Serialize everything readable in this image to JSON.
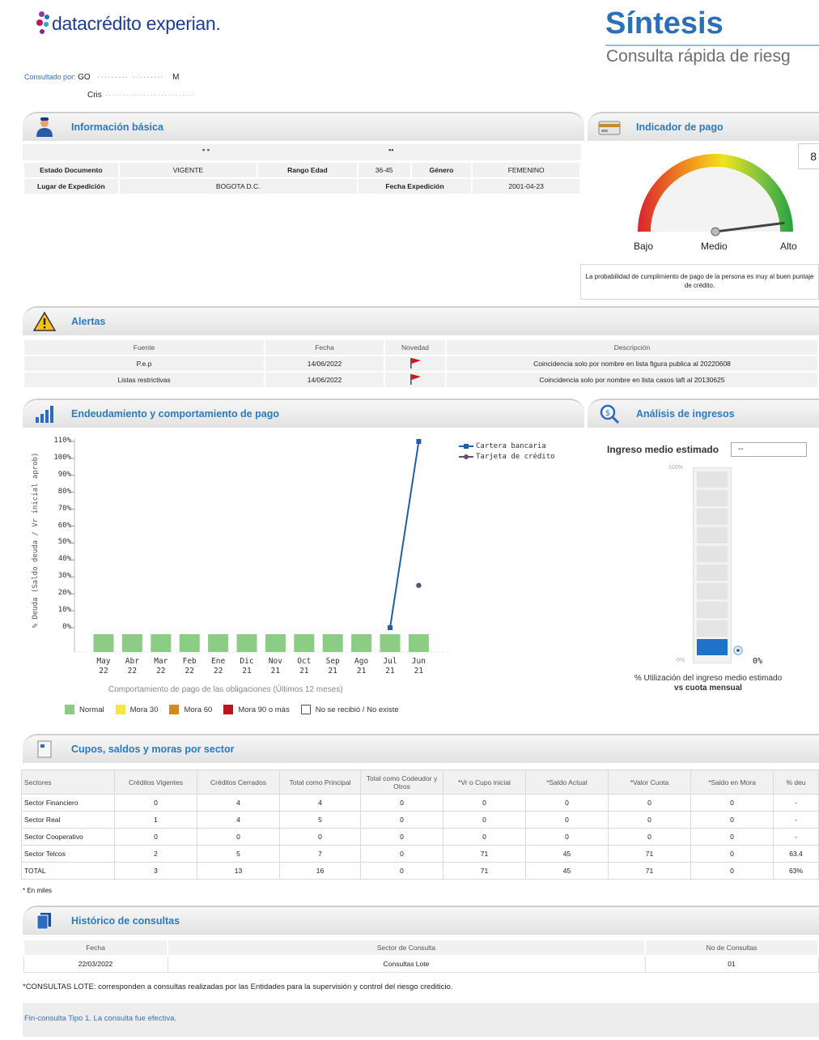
{
  "header": {
    "logo_text": "datacrédito experian.",
    "title": "Síntesis",
    "subtitle": "Consulta rápida de riesg",
    "consultado_label": "Consultado por:",
    "consultado_value": "GO",
    "consultado_tail": "M",
    "consultado_name": "Cris"
  },
  "info_basica": {
    "title": "Información básica",
    "rows": [
      [
        {
          "label": "Estado Documento",
          "value": "VIGENTE"
        },
        {
          "label": "Rango Edad",
          "value": "36-45"
        },
        {
          "label": "Género",
          "value": "FEMENINO"
        }
      ],
      [
        {
          "label": "Lugar de Expedición",
          "value": "BOGOTA D.C."
        },
        {
          "label": "Fecha Expedición",
          "value": "2001-04-23"
        }
      ]
    ]
  },
  "indicador": {
    "title": "Indicador de pago",
    "labels": [
      "Bajo",
      "Medio",
      "Alto"
    ],
    "score_box": "8",
    "level": 0.96,
    "note": "La probabilidad de cumplimiento de pago de la persona es muy al buen puntaje de crédito."
  },
  "alertas": {
    "title": "Alertas",
    "headers": [
      "Fuente",
      "Fecha",
      "Novedad",
      "Descripción"
    ],
    "rows": [
      {
        "fuente": "P.e.p",
        "fecha": "14/06/2022",
        "descripcion": "Coincidencia solo por nombre en lista figura publica al 20220608"
      },
      {
        "fuente": "Listas restrictivas",
        "fecha": "14/06/2022",
        "descripcion": "Coincidencia solo por nombre en lista casos laft al 20130625"
      }
    ]
  },
  "endeudamiento": {
    "title": "Endeudamiento y comportamiento de pago",
    "subtitle": "Comportamiento de pago de las obligaciones (Últimos 12 meses)",
    "pay_legend": [
      {
        "label": "Normal",
        "color": "#8ccc84"
      },
      {
        "label": "Mora 30",
        "color": "#f5e642"
      },
      {
        "label": "Mora 60",
        "color": "#d08a1e"
      },
      {
        "label": "Mora 90 o más",
        "color": "#c0121a"
      },
      {
        "label": "No se recibió / No existe",
        "color": "#ffffff"
      }
    ]
  },
  "chart_data": {
    "type": "line",
    "ylabel": "% Deuda (Saldo deuda / Vr inicial aprob)",
    "ylim": [
      0,
      110
    ],
    "yticks": [
      "110%",
      "100%",
      "90%",
      "80%",
      "70%",
      "60%",
      "50%",
      "40%",
      "30%",
      "20%",
      "10%",
      "0%"
    ],
    "categories": [
      {
        "m": "May",
        "y": "22"
      },
      {
        "m": "Abr",
        "y": "22"
      },
      {
        "m": "Mar",
        "y": "22"
      },
      {
        "m": "Feb",
        "y": "22"
      },
      {
        "m": "Ene",
        "y": "22"
      },
      {
        "m": "Dic",
        "y": "21"
      },
      {
        "m": "Nov",
        "y": "21"
      },
      {
        "m": "Oct",
        "y": "21"
      },
      {
        "m": "Sep",
        "y": "21"
      },
      {
        "m": "Ago",
        "y": "21"
      },
      {
        "m": "Jul",
        "y": "21"
      },
      {
        "m": "Jun",
        "y": "21"
      }
    ],
    "series": [
      {
        "name": "Cartera bancaria",
        "color": "#1f5fa6",
        "points": [
          {
            "i": 10,
            "v": 0
          },
          {
            "i": 11,
            "v": 110
          }
        ]
      },
      {
        "name": "Tarjeta de crédito",
        "color": "#6b4a7a",
        "points": [
          {
            "i": 11,
            "v": 25
          }
        ]
      }
    ],
    "behavior": [
      "Normal",
      "Normal",
      "Normal",
      "Normal",
      "Normal",
      "Normal",
      "Normal",
      "Normal",
      "Normal",
      "Normal",
      "Normal",
      "Normal"
    ]
  },
  "ingresos": {
    "title": "Análisis de ingresos",
    "label": "Ingreso medio estimado",
    "value": "--",
    "top_label": "100%",
    "bottom_label": "0%",
    "pct": "0%",
    "caption1": "% Utilización del ingreso medio estimado",
    "caption2": "vs cuota mensual"
  },
  "cupos": {
    "title": "Cupos, saldos y moras por sector",
    "headers": [
      "Sectores",
      "Créditos Vigentes",
      "Créditos Cerrados",
      "Total como Principal",
      "Total como Codeudor y Otros",
      "*Vr o Cupo inicial",
      "*Saldo Actual",
      "*Valor Cuota",
      "*Saldo en Mora",
      "% deu"
    ],
    "rows": [
      [
        "Sector Financiero",
        "0",
        "4",
        "4",
        "0",
        "0",
        "0",
        "0",
        "0",
        "-"
      ],
      [
        "Sector Real",
        "1",
        "4",
        "5",
        "0",
        "0",
        "0",
        "0",
        "0",
        "-"
      ],
      [
        "Sector Cooperativo",
        "0",
        "0",
        "0",
        "0",
        "0",
        "0",
        "0",
        "0",
        "-"
      ],
      [
        "Sector Telcos",
        "2",
        "5",
        "7",
        "0",
        "71",
        "45",
        "71",
        "0",
        "63.4"
      ],
      [
        "TOTAL",
        "3",
        "13",
        "16",
        "0",
        "71",
        "45",
        "71",
        "0",
        "63%"
      ]
    ],
    "footnote": "* En miles"
  },
  "historico": {
    "title": "Histórico de consultas",
    "headers": [
      "Fecha",
      "Sector de Consulta",
      "No de Consultas"
    ],
    "rows": [
      [
        "22/03/2022",
        "Consultas Lote",
        "01"
      ]
    ],
    "note": "*CONSULTAS LOTE: corresponden a consultas realizadas por las Entidades para la supervisión y control del riesgo crediticio.",
    "end": "Fin-consulta Tipo 1. La consulta fue efectiva."
  },
  "colors": {
    "accent": "#2b7ac0",
    "title": "#2a6fb8",
    "line": "#1f5fa6",
    "flag": "#d0141a"
  }
}
